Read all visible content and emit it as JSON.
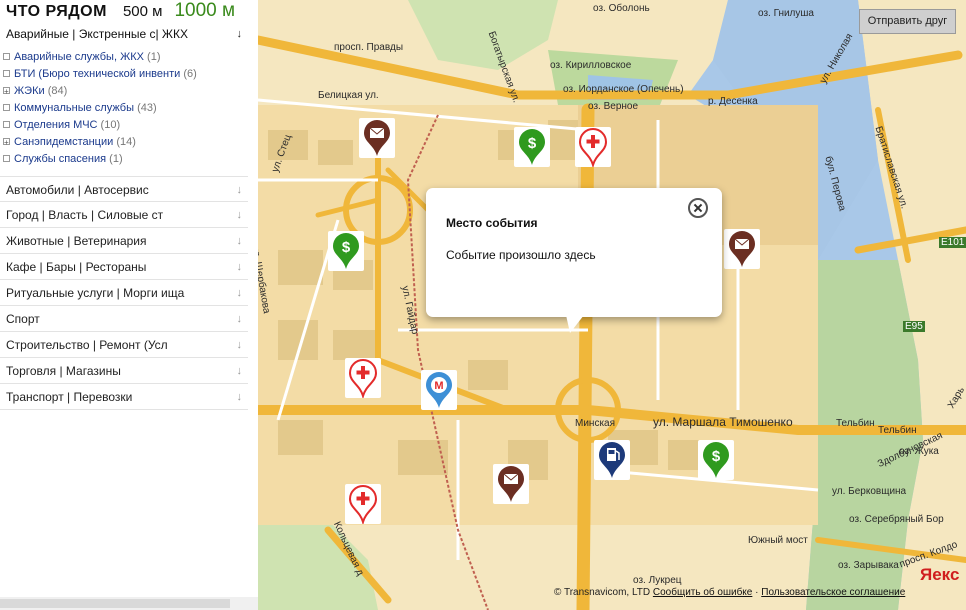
{
  "header": {
    "title": "ЧТО РЯДОМ",
    "radius_small": "500 м",
    "radius_large": "1000 м"
  },
  "sidebar": {
    "open_category": "Аварийные | Экстренные с| ЖКХ",
    "subitems": [
      {
        "label": "Аварийные службы, ЖКХ",
        "count": "(1)",
        "expandable": false
      },
      {
        "label": "БТИ (Бюро технической инвенти",
        "count": "(6)",
        "expandable": false
      },
      {
        "label": "ЖЭКи",
        "count": "(84)",
        "expandable": true
      },
      {
        "label": "Коммунальные службы",
        "count": "(43)",
        "expandable": false
      },
      {
        "label": "Отделения МЧС",
        "count": "(10)",
        "expandable": false
      },
      {
        "label": "Санэпидемстанции",
        "count": "(14)",
        "expandable": true
      },
      {
        "label": "Службы спасения",
        "count": "(1)",
        "expandable": false
      }
    ],
    "categories": [
      "Автомобили | Автосервис",
      "Город | Власть | Силовые ст",
      "Животные | Ветеринария",
      "Кафе | Бары | Рестораны",
      "Ритуальные услуги | Морги ища",
      "Спорт",
      "Строительство | Ремонт (Усл",
      "Торговля | Магазины",
      "Транспорт | Перевозки"
    ]
  },
  "map": {
    "send_button": "Отправить друг",
    "popup": {
      "title": "Место события",
      "text": "Событие произошло здесь"
    },
    "labels": {
      "obolon": "оз. Оболонь",
      "gnilusha": "оз. Гнилуша",
      "pravdy": "просп. Правды",
      "belitska": "Белицкая ул.",
      "bogatyrska": "Богатырская ул.",
      "kirillovskoe": "оз. Кирилловское",
      "iordanskoe": "оз. Иорданское (Опечень)",
      "vernoe": "оз. Верное",
      "desenka": "р. Десенка",
      "nikolai": "ул. Николая",
      "stets": "ул. Стец",
      "sherbakova": "ул. Щербакова",
      "perova": "бул. Перова",
      "bratislav": "Братиславская ул.",
      "gaidar": "ул. Гайдар",
      "e101": "E101",
      "e95": "E95",
      "minska": "Минская",
      "tymoshenko": "ул. Маршала Тимошенко",
      "kharkiv": "Харь",
      "telbin1": "Тельбин",
      "telbin2": "Тельбин",
      "zdolbun": "Здолбуновская",
      "zhuki": "оз. Жука",
      "berkovsch": "ул. Берковщина",
      "serebryany": "оз. Серебряный Бор",
      "yuzhny": "Южный мост",
      "kolceva": "Кольцевая д",
      "lukrets": "оз. Лукрец",
      "zaryvaka": "оз. Зарывака",
      "koldor": "просп. Колдо"
    },
    "copyright": "© Transnavicom, LTD",
    "report_link": "Сообщить об ошибке",
    "terms_link": "Пользовательское соглашение",
    "logo": "Яекс"
  },
  "markers": [
    {
      "name": "mail-marker-1",
      "icon": "mail-icon",
      "color": "#6b2e22"
    },
    {
      "name": "money-marker-1",
      "icon": "dollar-icon",
      "color": "#2f9a1e"
    },
    {
      "name": "medical-marker-1",
      "icon": "medical-cross-icon",
      "color": "#e32b2b"
    },
    {
      "name": "money-marker-2",
      "icon": "dollar-icon",
      "color": "#2f9a1e"
    },
    {
      "name": "mail-marker-2",
      "icon": "mail-icon",
      "color": "#6b2e22"
    },
    {
      "name": "medical-marker-2",
      "icon": "medical-cross-icon",
      "color": "#e32b2b"
    },
    {
      "name": "metro-marker",
      "icon": "metro-icon",
      "color": "#3d8fd6"
    },
    {
      "name": "mail-marker-3",
      "icon": "mail-icon",
      "color": "#6b2e22"
    },
    {
      "name": "fuel-marker",
      "icon": "fuel-icon",
      "color": "#1d3a7a"
    },
    {
      "name": "money-marker-3",
      "icon": "dollar-icon",
      "color": "#2f9a1e"
    },
    {
      "name": "medical-marker-3",
      "icon": "medical-cross-icon",
      "color": "#e32b2b"
    }
  ]
}
